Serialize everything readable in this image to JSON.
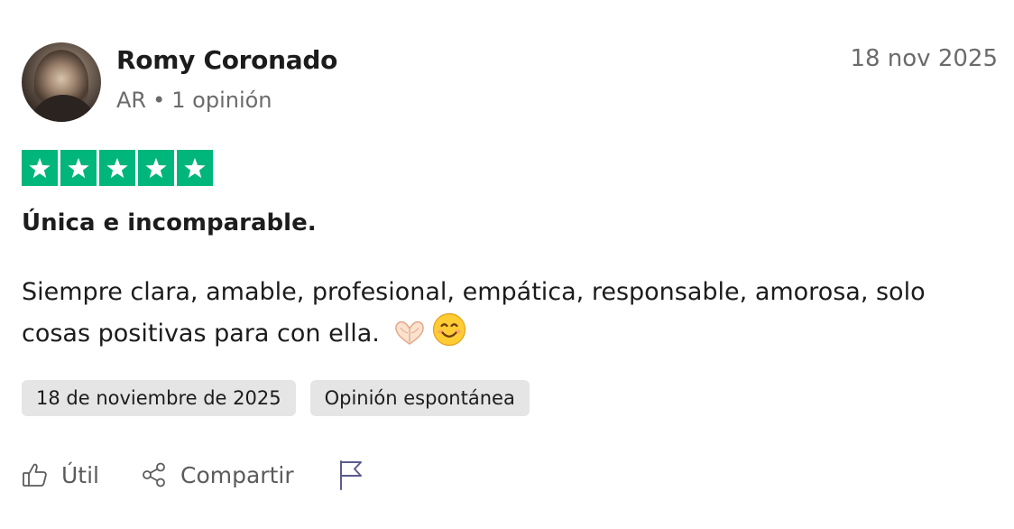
{
  "review": {
    "author": "Romy Coronado",
    "country": "AR",
    "separator": "•",
    "review_count": "1 opinión",
    "date_short": "18 nov 2025",
    "rating": 5,
    "rating_max": 5,
    "title": "Única e incomparable.",
    "body": "Siempre clara, amable, profesional, empática, responsable, amorosa, solo cosas positivas para con ella.",
    "emojis": [
      "heart-hands-emoji",
      "smiling-face-emoji"
    ],
    "tags": {
      "date_long": "18 de noviembre de 2025",
      "type": "Opinión espontánea"
    }
  },
  "actions": {
    "useful_label": "Útil",
    "share_label": "Compartir",
    "icons": [
      "thumbs-up-icon",
      "share-icon",
      "flag-icon"
    ]
  },
  "colors": {
    "star_green": "#00b67a",
    "tag_bg": "#e5e5e5",
    "muted_text": "#6b6b6b",
    "flag_purple": "#5c5a8f"
  }
}
